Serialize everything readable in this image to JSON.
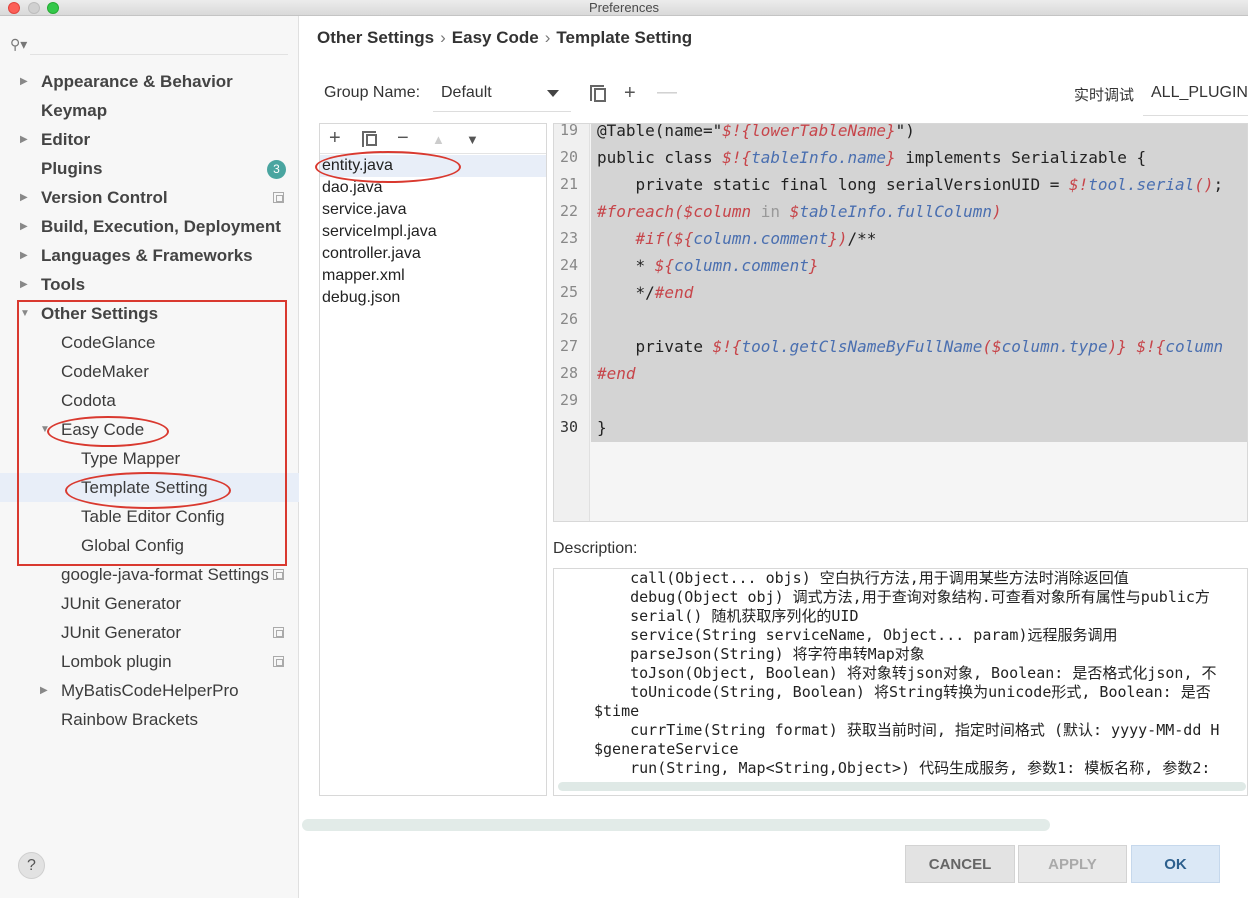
{
  "window": {
    "title": "Preferences"
  },
  "sidebar": {
    "search_placeholder": "",
    "items": [
      {
        "label": "Appearance & Behavior"
      },
      {
        "label": "Keymap"
      },
      {
        "label": "Editor"
      },
      {
        "label": "Plugins",
        "badge": "3"
      },
      {
        "label": "Version Control"
      },
      {
        "label": "Build, Execution, Deployment"
      },
      {
        "label": "Languages & Frameworks"
      },
      {
        "label": "Tools"
      },
      {
        "label": "Other Settings"
      },
      {
        "label": "CodeGlance"
      },
      {
        "label": "CodeMaker"
      },
      {
        "label": "Codota"
      },
      {
        "label": "Easy Code"
      },
      {
        "label": "Type Mapper"
      },
      {
        "label": "Template Setting"
      },
      {
        "label": "Table Editor Config"
      },
      {
        "label": "Global Config"
      },
      {
        "label": "google-java-format Settings"
      },
      {
        "label": "JUnit Generator"
      },
      {
        "label": "JUnit Generator"
      },
      {
        "label": "Lombok plugin"
      },
      {
        "label": "MyBatisCodeHelperPro"
      },
      {
        "label": "Rainbow Brackets"
      }
    ]
  },
  "breadcrumb": [
    "Other Settings",
    "Easy Code",
    "Template Setting"
  ],
  "group": {
    "label": "Group Name:",
    "value": "Default"
  },
  "realtime": {
    "label": "实时调试",
    "value": "ALL_PLUGIN"
  },
  "files": [
    "entity.java",
    "dao.java",
    "service.java",
    "serviceImpl.java",
    "controller.java",
    "mapper.xml",
    "debug.json"
  ],
  "editor": {
    "line_numbers": [
      "19",
      "20",
      "21",
      "22",
      "23",
      "24",
      "25",
      "26",
      "27",
      "28",
      "29",
      "30"
    ]
  },
  "description": {
    "label": "Description:",
    "lines": [
      "    call(Object... objs) 空白执行方法,用于调用某些方法时消除返回值",
      "    debug(Object obj) 调式方法,用于查询对象结构.可查看对象所有属性与public方",
      "    serial() 随机获取序列化的UID",
      "    service(String serviceName, Object... param)远程服务调用",
      "    parseJson(String) 将字符串转Map对象",
      "    toJson(Object, Boolean) 将对象转json对象, Boolean: 是否格式化json, 不",
      "    toUnicode(String, Boolean) 将String转换为unicode形式, Boolean: 是否",
      "$time",
      "    currTime(String format) 获取当前时间, 指定时间格式 (默认: yyyy-MM-dd H",
      "$generateService",
      "    run(String, Map<String,Object>) 代码生成服务, 参数1: 模板名称, 参数2:"
    ]
  },
  "buttons": {
    "help": "?",
    "cancel": "CANCEL",
    "apply": "APPLY",
    "ok": "OK"
  },
  "colors": {
    "annotation": "#d9392f",
    "selection": "#e8eef8",
    "badge": "#4aa5a0"
  }
}
